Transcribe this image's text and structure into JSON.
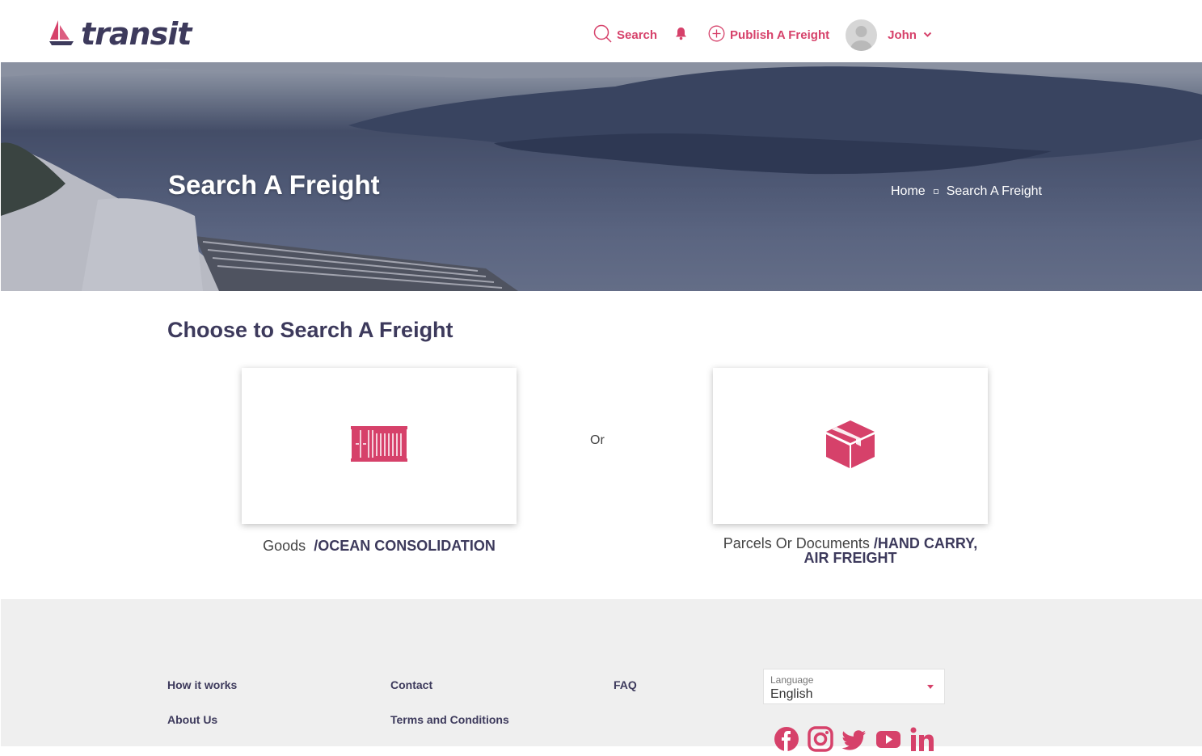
{
  "brand": {
    "name": "transit",
    "accent_color": "#d6416a",
    "dark_color": "#3d3a5c"
  },
  "nav": {
    "search_label": "Search",
    "bell_icon": "bell-icon",
    "publish_label": "Publish A Freight",
    "user_name": "John"
  },
  "hero": {
    "title": "Search A Freight",
    "breadcrumb": {
      "home": "Home",
      "current": "Search A Freight"
    }
  },
  "main": {
    "title": "Choose to Search A Freight",
    "or_text": "Or",
    "cards": [
      {
        "icon": "shipping-container-icon",
        "label_regular": "Goods",
        "label_strong": "/OCEAN CONSOLIDATION"
      },
      {
        "icon": "parcel-box-icon",
        "label_regular": "Parcels Or Documents",
        "label_strong": "/HAND CARRY, AIR FREIGHT"
      }
    ]
  },
  "footer": {
    "links": {
      "how_it_works": "How it works",
      "contact": "Contact",
      "faq": "FAQ",
      "about_us": "About Us",
      "terms": "Terms and Conditions"
    },
    "language": {
      "label": "Language",
      "value": "English"
    },
    "socials": [
      "facebook-icon",
      "instagram-icon",
      "twitter-icon",
      "youtube-icon",
      "linkedin-icon"
    ]
  }
}
